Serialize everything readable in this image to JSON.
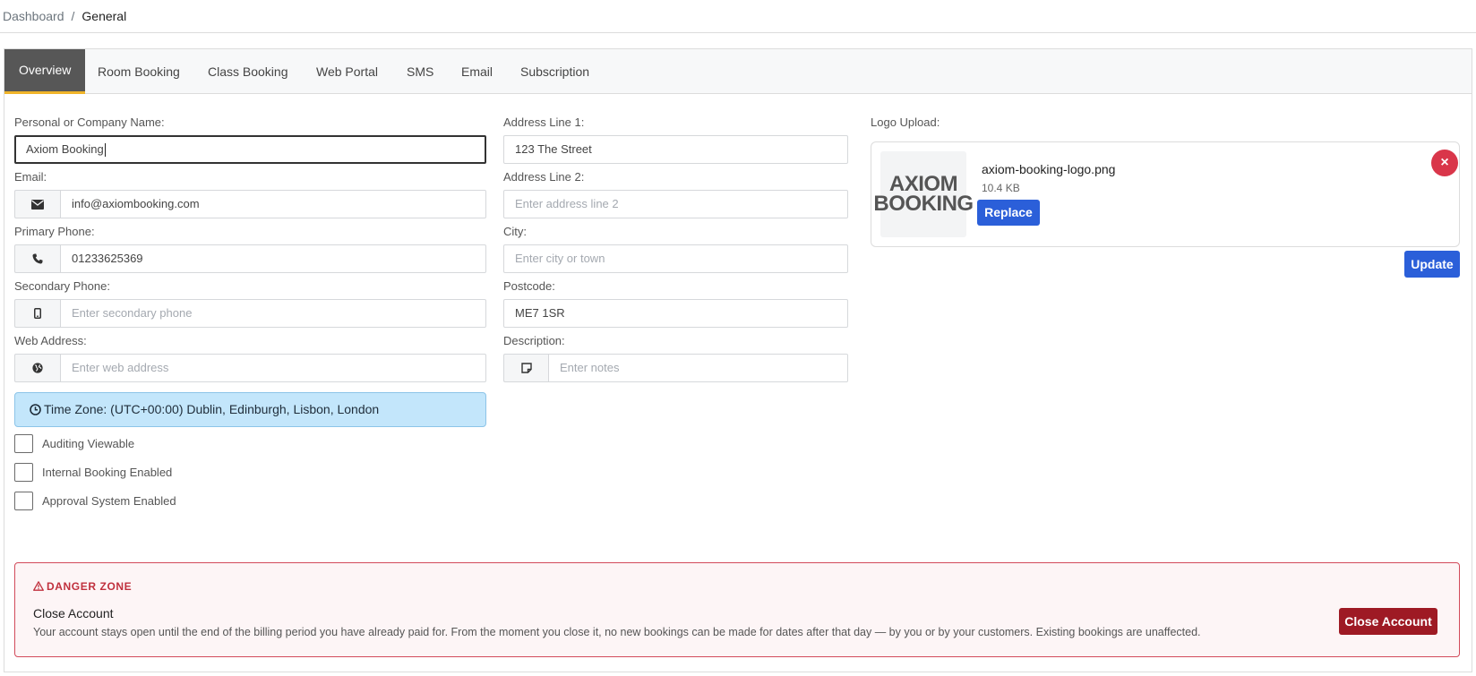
{
  "breadcrumb": {
    "parent": "Dashboard",
    "separator": "/",
    "current": "General"
  },
  "tabs": [
    {
      "label": "Overview",
      "active": true
    },
    {
      "label": "Room Booking"
    },
    {
      "label": "Class Booking"
    },
    {
      "label": "Web Portal"
    },
    {
      "label": "SMS"
    },
    {
      "label": "Email"
    },
    {
      "label": "Subscription"
    }
  ],
  "form": {
    "company_name": {
      "label": "Personal or Company Name:",
      "value": "Axiom Booking"
    },
    "email": {
      "label": "Email:",
      "value": "info@axiombooking.com",
      "icon": "envelope-icon"
    },
    "primary_phone": {
      "label": "Primary Phone:",
      "value": "01233625369",
      "icon": "phone-icon"
    },
    "secondary_phone": {
      "label": "Secondary Phone:",
      "placeholder": "Enter secondary phone",
      "icon": "mobile-icon"
    },
    "web_address": {
      "label": "Web Address:",
      "placeholder": "Enter web address",
      "icon": "globe-icon"
    },
    "address1": {
      "label": "Address Line 1:",
      "value": "123 The Street"
    },
    "address2": {
      "label": "Address Line 2:",
      "placeholder": "Enter address line 2"
    },
    "city": {
      "label": "City:",
      "placeholder": "Enter city or town"
    },
    "postcode": {
      "label": "Postcode:",
      "value": "ME7 1SR"
    },
    "description": {
      "label": "Description:",
      "placeholder": "Enter notes",
      "icon": "sticky-note-icon"
    }
  },
  "timezone": {
    "text": "Time Zone: (UTC+00:00) Dublin, Edinburgh, Lisbon, London",
    "icon": "clock-icon",
    "background": "#c3e6fb"
  },
  "checkboxes": [
    {
      "label": "Auditing Viewable",
      "checked": false
    },
    {
      "label": "Internal Booking Enabled",
      "checked": false
    },
    {
      "label": "Approval System Enabled",
      "checked": false
    }
  ],
  "logo": {
    "label": "Logo Upload:",
    "logo_line1": "AXIOM",
    "logo_line2": "BOOKING",
    "file_name": "axiom-booking-logo.png",
    "file_size": "10.4 KB",
    "replace_label": "Replace",
    "remove_symbol": "×",
    "update_label": "Update"
  },
  "danger_zone": {
    "title": "DANGER ZONE",
    "heading": "Close Account",
    "description": "Your account stays open until the end of the billing period you have already paid for. From the moment you close it, no new bookings can be made for dates after that day — by you or by your customers. Existing bookings are unaffected.",
    "button_label": "Close Account",
    "color": "#c0303d"
  },
  "colors": {
    "primary": "#2b5fd9",
    "danger": "#9e1a24",
    "tab_active": "#575757",
    "tab_accent": "#f0b429"
  }
}
